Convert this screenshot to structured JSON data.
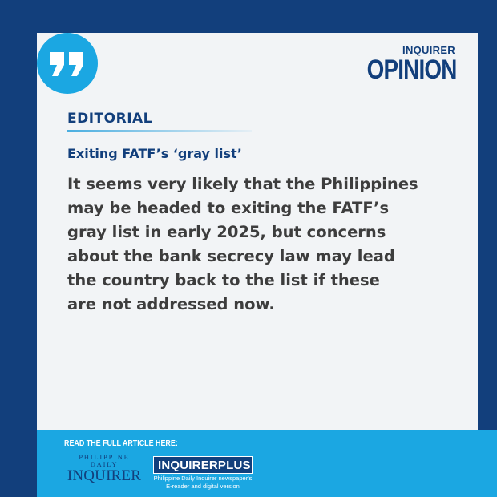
{
  "brand": {
    "logo_small": "INQUIRER",
    "logo_big": "OPINION"
  },
  "section_label": "EDITORIAL",
  "headline": "Exiting FATF’s ‘gray list’",
  "body_lines": [
    "It seems very likely that the Philippines",
    "may be headed to exiting the FATF’s",
    "gray list in early 2025, but concerns",
    "about the bank secrecy law may lead",
    "the country back to the list if these",
    "are not addressed now."
  ],
  "footer": {
    "read_full": "READ THE FULL ARTICLE HERE:",
    "pdi_top": "PHILIPPINE DAILY",
    "pdi_bottom": "INQUIRER",
    "plus_label": "INQUIRERPLUS",
    "plus_desc_1": "Philippine Daily Inquirer newspaper's",
    "plus_desc_2": "E-reader and digital version"
  },
  "colors": {
    "navy": "#123f7c",
    "sky": "#1ba7e2",
    "card": "#f2f4f6",
    "text": "#3d3d3d"
  },
  "icons": [
    "quote-icon"
  ]
}
